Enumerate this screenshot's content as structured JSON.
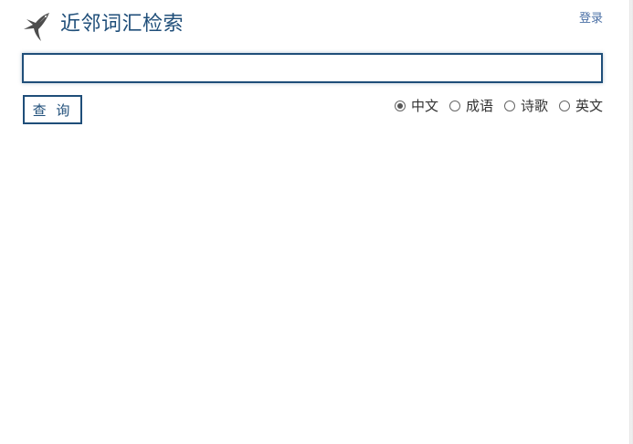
{
  "header": {
    "logo_icon": "bird-logo-icon",
    "title": "近邻词汇检索",
    "login_label": "登录"
  },
  "search": {
    "value": "",
    "placeholder": ""
  },
  "query_button": {
    "label": "查 询"
  },
  "radio_options": [
    {
      "label": "中文",
      "selected": true
    },
    {
      "label": "成语",
      "selected": false
    },
    {
      "label": "诗歌",
      "selected": false
    },
    {
      "label": "英文",
      "selected": false
    }
  ],
  "colors": {
    "brand": "#1f4e79",
    "link": "#4a6fa5",
    "text": "#333333"
  }
}
